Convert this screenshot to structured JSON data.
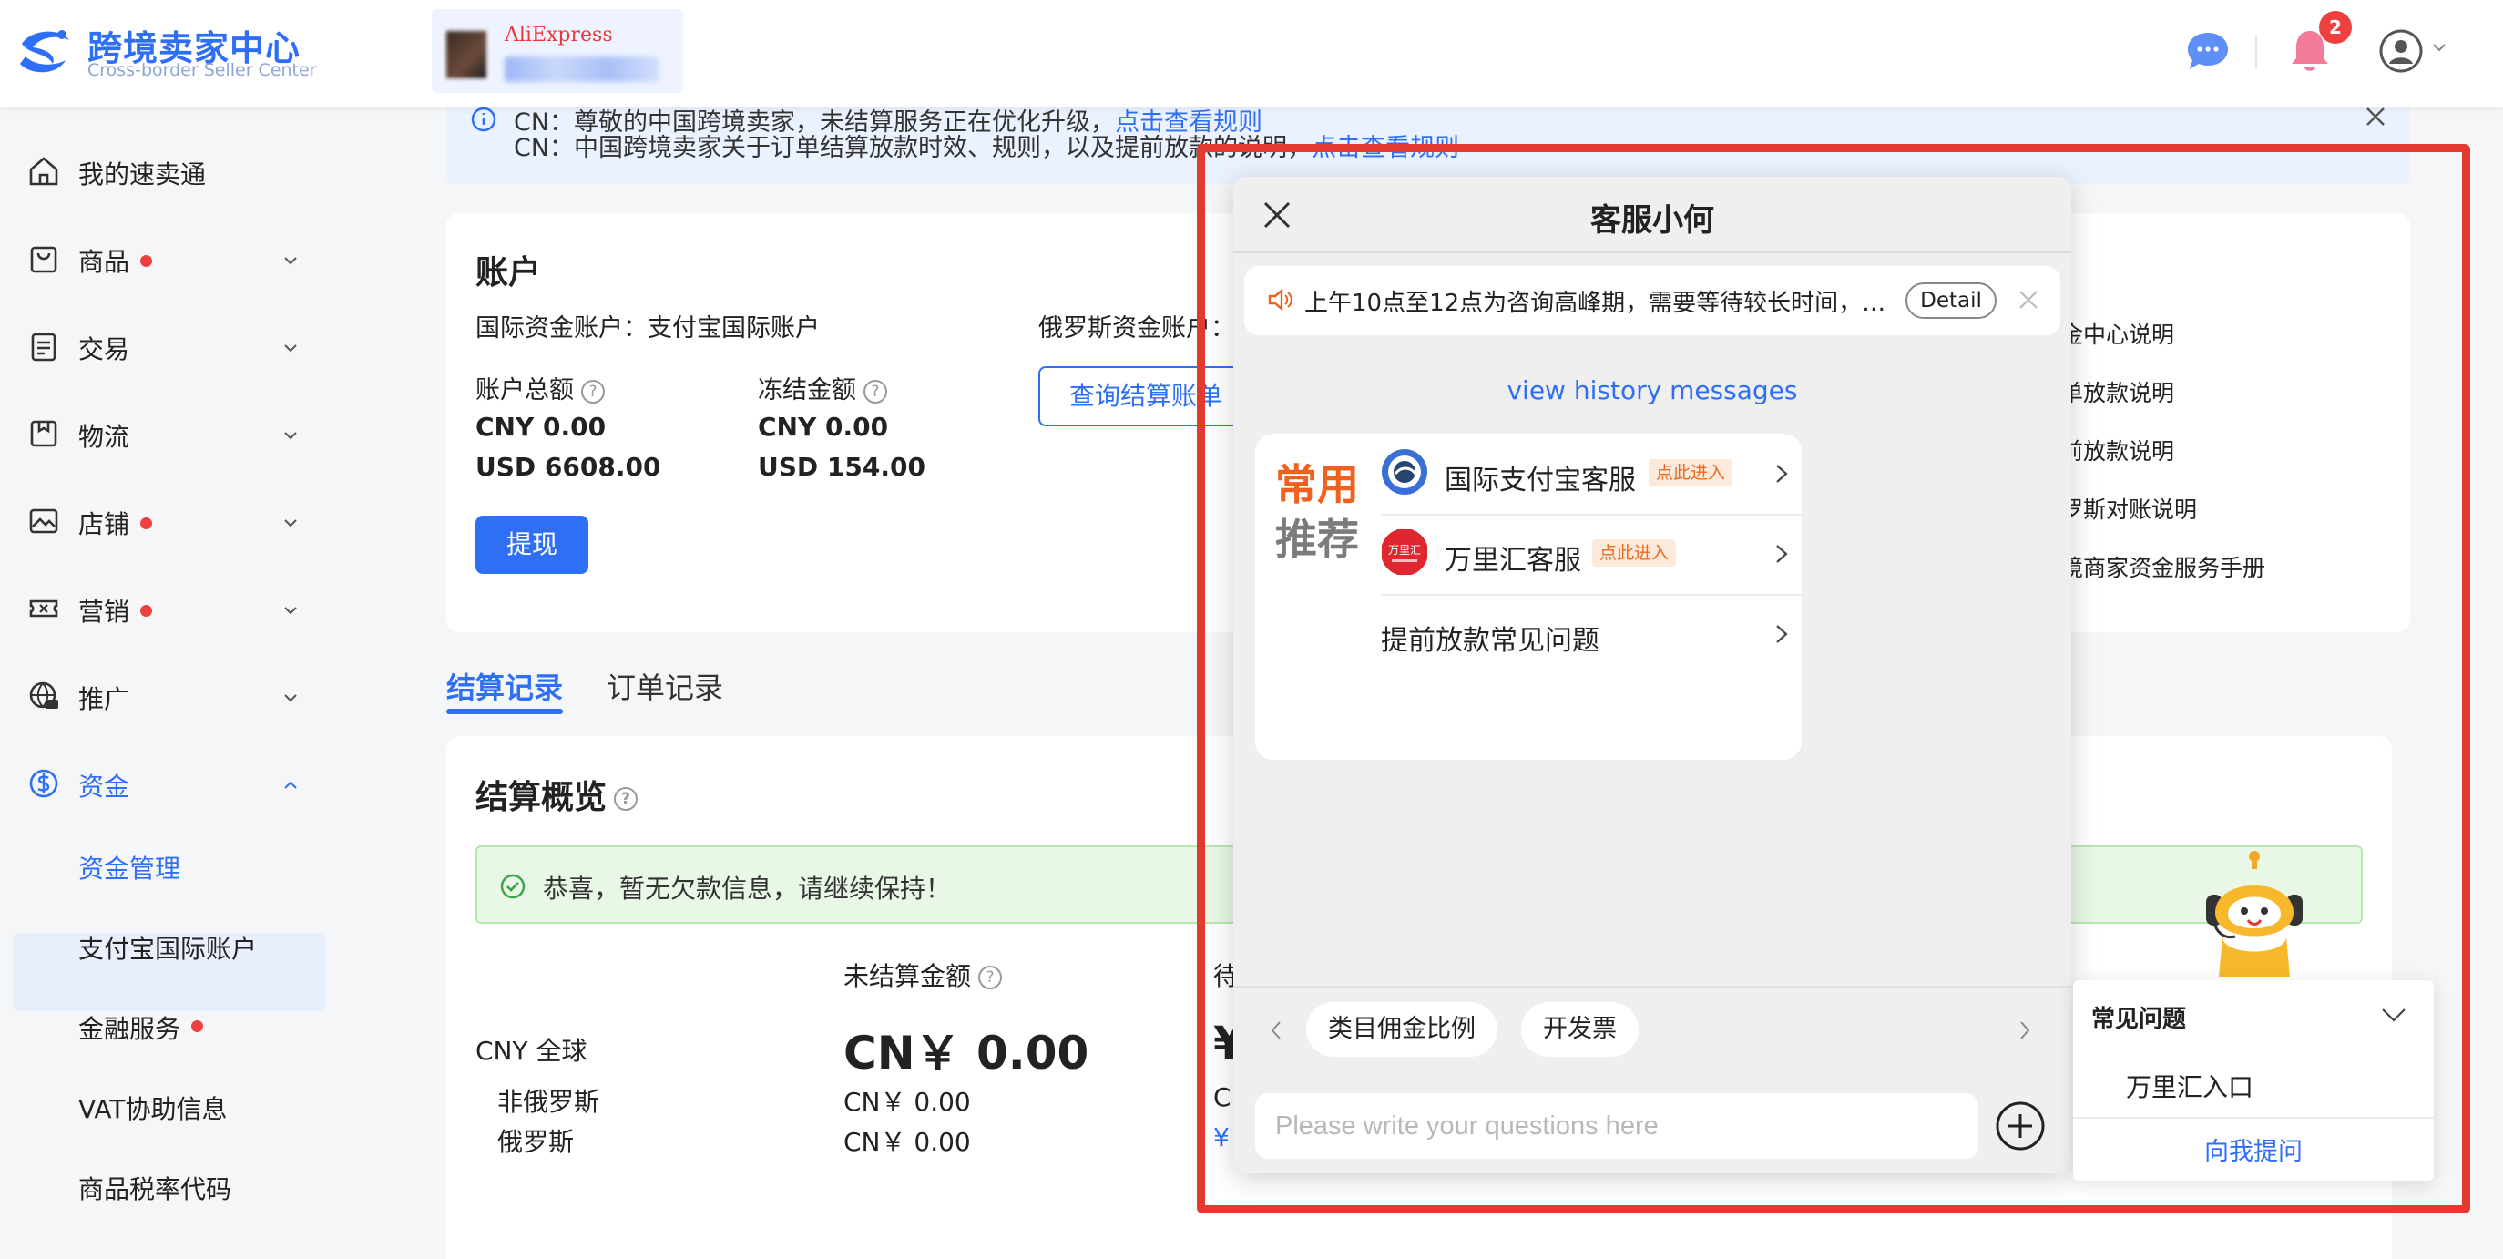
{
  "header": {
    "logo_title": "跨境卖家中心",
    "logo_subtitle": "Cross-border Seller Center",
    "store_name": "AliExpress",
    "notification_count": "2"
  },
  "sidebar": {
    "items": [
      {
        "label": "我的速卖通"
      },
      {
        "label": "商品"
      },
      {
        "label": "交易"
      },
      {
        "label": "物流"
      },
      {
        "label": "店铺"
      },
      {
        "label": "营销"
      },
      {
        "label": "推广"
      },
      {
        "label": "资金"
      }
    ],
    "sub_items": [
      {
        "label": "资金管理"
      },
      {
        "label": "支付宝国际账户"
      },
      {
        "label": "金融服务"
      },
      {
        "label": "VAT协助信息"
      },
      {
        "label": "商品税率代码"
      }
    ]
  },
  "notice": {
    "line1_text": "CN：尊敬的中国跨境卖家，未结算服务正在优化升级，",
    "line1_link": "点击查看规则",
    "line2_text": "CN：中国跨境卖家关于订单结算放款时效、规则，以及提前放款的说明，",
    "line2_link": "点击查看规则"
  },
  "account": {
    "title": "账户",
    "intl_account": "国际资金账户：支付宝国际账户",
    "ru_account": "俄罗斯资金账户：",
    "total_label": "账户总额",
    "frozen_label": "冻结金额",
    "total_cny": "CNY 0.00",
    "total_usd": "USD 6608.00",
    "frozen_cny": "CNY 0.00",
    "frozen_usd": "USD 154.00",
    "withdraw_label": "提现",
    "query_label": "查询结算账单",
    "right_links": [
      "金中心说明",
      "单放款说明",
      "前放款说明",
      "罗斯对账说明",
      "境商家资金服务手册"
    ]
  },
  "tabs": {
    "settlement": "结算记录",
    "order": "订单记录"
  },
  "overview": {
    "title": "结算概览",
    "success_text": "恭喜，暂无欠款信息，请继续保持！",
    "col_unsettled": "未结算金额",
    "col_pending": "待",
    "row_global": "CNY 全球",
    "row_non_ru": "非俄罗斯",
    "row_ru": "俄罗斯",
    "big_amount": "CN￥ 0.00",
    "non_ru_amount": "CN￥ 0.00",
    "ru_amount": "CN￥ 0.00",
    "partial_big": "¥",
    "partial_cn": "CI",
    "partial_blue": "¥"
  },
  "chat": {
    "title": "客服小何",
    "announcement": "上午10点至12点为咨询高峰期，需要等待较长时间，…",
    "detail_label": "Detail",
    "history_link": "view history messages",
    "rec_word1": "常用",
    "rec_word2": "推荐",
    "rec_items": [
      {
        "name": "国际支付宝客服",
        "tag": "点此进入"
      },
      {
        "name": "万里汇客服",
        "tag": "点此进入"
      },
      {
        "name": "提前放款常见问题"
      }
    ],
    "quick_chips": [
      "类目佣金比例",
      "开发票"
    ],
    "input_placeholder": "Please write your questions here"
  },
  "faq": {
    "title": "常见问题",
    "item": "万里汇入口",
    "ask_label": "向我提问"
  },
  "colors": {
    "accent": "#2f6ff5",
    "alert_red": "#e23a2e",
    "badge_red": "#ee4040",
    "highlight_orange": "#f0611f",
    "success_bg": "#e8f7e6"
  }
}
